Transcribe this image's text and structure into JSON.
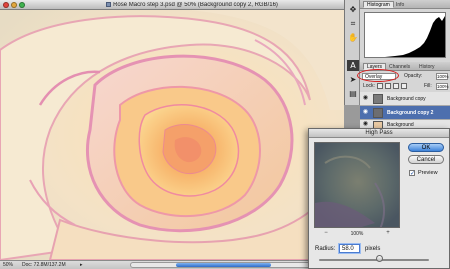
{
  "document": {
    "title": "Rose Macro step 3.psd @ 50% (Background copy 2, RGB/16)",
    "status_zoom": "50%",
    "status_doc": "Doc: 72.8M/137.2M",
    "status_arrow": "▸"
  },
  "tools": [
    "move-tool",
    "crop-tool",
    "hand-tool",
    "type-tool",
    "path-selection-tool",
    "notes-tool"
  ],
  "panels": {
    "histogram_tabs": [
      "Histogram",
      "Info"
    ],
    "layers_tabs": [
      "Layers",
      "Channels",
      "History"
    ],
    "blend_mode": "Overlay",
    "opacity_label": "Opacity:",
    "opacity_value": "100%",
    "lock_label": "Lock:",
    "fill_label": "Fill:",
    "fill_value": "100%",
    "layers": [
      {
        "name": "Background copy",
        "selected": false
      },
      {
        "name": "Background copy 2",
        "selected": true
      },
      {
        "name": "Background",
        "selected": false
      }
    ]
  },
  "highpass": {
    "title": "High Pass",
    "ok_label": "OK",
    "cancel_label": "Cancel",
    "preview_label": "Preview",
    "preview_checked": true,
    "zoom_value": "100%",
    "zoom_out": "−",
    "zoom_in": "+",
    "radius_label": "Radius:",
    "radius_value": "58.0",
    "radius_unit": "pixels",
    "radius_slider_fraction": 0.55
  },
  "colors": {
    "highlight_oval": "#d81d1d",
    "selected_layer": "#4d6fae",
    "ok_button": "#3d82d9"
  }
}
